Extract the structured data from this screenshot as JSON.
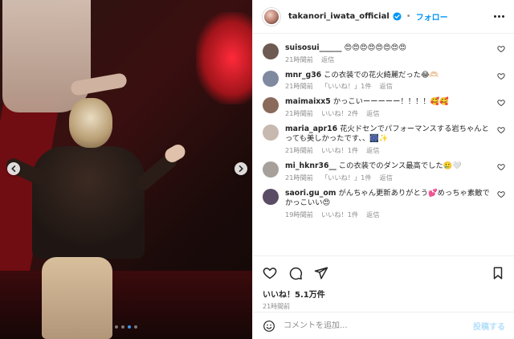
{
  "post": {
    "author": "takanori_iwata_official",
    "follow_label": "フォロー",
    "dot": "•",
    "likes": "いいね！5.1万件",
    "time": "21時間前",
    "carousel": {
      "slide_count": 4,
      "active_index": 2
    }
  },
  "comments": [
    {
      "user": "suisosui______",
      "text": "😍😍😍😍😍😍😍😍",
      "time": "21時間前",
      "likes": "",
      "reply": "返信",
      "avatar_color": "#6d5a52"
    },
    {
      "user": "mnr_g36",
      "text": "この衣装での花火綺麗だった😂🫶🏻",
      "time": "21時間前",
      "likes": "「いいね！」1件",
      "reply": "返信",
      "avatar_color": "#7f8aa1"
    },
    {
      "user": "maimaixx5",
      "text": "かっこいーーーーー！！！！🥰🥰",
      "time": "21時間前",
      "likes": "いいね！2件",
      "reply": "返信",
      "avatar_color": "#8a6a5a"
    },
    {
      "user": "maria_apr16",
      "text": "花火ドセンでパフォーマンスする岩ちゃんとっても美しかったです、、🎆✨",
      "time": "21時間前",
      "likes": "いいね！1件",
      "reply": "返信",
      "avatar_color": "#c7b9b0"
    },
    {
      "user": "mi_hknr36__",
      "text": "この衣装でのダンス最高でした🥲🤍",
      "time": "21時間前",
      "likes": "「いいね！」1件",
      "reply": "返信",
      "avatar_color": "#a7a09a"
    },
    {
      "user": "saori.gu_om",
      "text": "がんちゃん更新ありがとう💕めっちゃ素敵でかっこいい😍",
      "time": "19時間前",
      "likes": "いいね！1件",
      "reply": "返信",
      "avatar_color": "#5a4c64"
    }
  ],
  "add_comment": {
    "placeholder": "コメントを追加...",
    "post_label": "投稿する"
  },
  "icons": {
    "verified": "verified-badge-icon",
    "more": "more-options-icon",
    "like": "heart-icon",
    "comment": "comment-icon",
    "share": "share-icon",
    "save": "bookmark-icon",
    "emoji": "emoji-icon",
    "prev": "chevron-left-icon",
    "next": "chevron-right-icon"
  },
  "colors": {
    "link_blue": "#0095f6",
    "carousel_active": "#3897f0",
    "post_disabled": "#b2dffc"
  }
}
